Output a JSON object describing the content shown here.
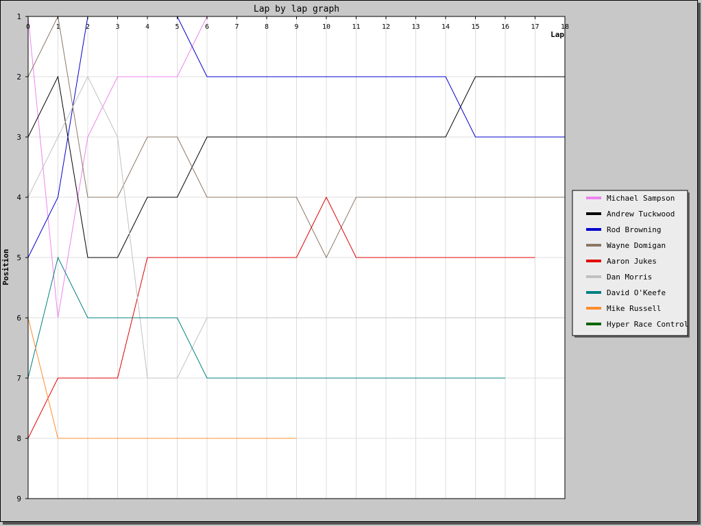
{
  "chart_data": {
    "type": "line",
    "title": "Lap by lap graph",
    "xlabel": "Lap",
    "ylabel": "Position",
    "xlim": [
      0,
      18
    ],
    "ylim": [
      1,
      9
    ],
    "y_inverted": true,
    "x_ticks": [
      0,
      1,
      2,
      3,
      4,
      5,
      6,
      7,
      8,
      9,
      10,
      11,
      12,
      13,
      14,
      15,
      16,
      17,
      18
    ],
    "y_ticks": [
      1,
      2,
      3,
      4,
      5,
      6,
      7,
      8,
      9
    ],
    "grid": true,
    "legend_position": "right",
    "series": [
      {
        "name": "Michael Sampson",
        "color": "#ee82ee",
        "x": [
          0,
          1,
          2,
          3,
          4,
          5,
          6,
          7,
          8,
          9,
          10,
          11,
          12,
          13,
          14,
          15,
          16,
          17,
          18
        ],
        "y": [
          1,
          6,
          3,
          2,
          2,
          2,
          1,
          1,
          1,
          1,
          1,
          1,
          1,
          1,
          1,
          1,
          1,
          1,
          1
        ]
      },
      {
        "name": "Andrew Tuckwood",
        "color": "#000000",
        "x": [
          0,
          1,
          2,
          3,
          4,
          5,
          6,
          7,
          8,
          9,
          10,
          11,
          12,
          13,
          14,
          15,
          16,
          17,
          18
        ],
        "y": [
          3,
          2,
          5,
          5,
          4,
          4,
          3,
          3,
          3,
          3,
          3,
          3,
          3,
          3,
          3,
          2,
          2,
          2,
          2
        ]
      },
      {
        "name": "Rod Browning",
        "color": "#0000cc",
        "x": [
          0,
          1,
          2,
          3,
          4,
          5,
          6,
          7,
          8,
          9,
          10,
          11,
          12,
          13,
          14,
          15,
          16,
          17,
          18
        ],
        "y": [
          5,
          4,
          1,
          1,
          1,
          1,
          2,
          2,
          2,
          2,
          2,
          2,
          2,
          2,
          2,
          3,
          3,
          3,
          3
        ]
      },
      {
        "name": "Wayne Domigan",
        "color": "#8b7765",
        "x": [
          0,
          1,
          2,
          3,
          4,
          5,
          6,
          7,
          8,
          9,
          10,
          11,
          12,
          13,
          14,
          15,
          16,
          17,
          18
        ],
        "y": [
          2,
          1,
          4,
          4,
          3,
          3,
          4,
          4,
          4,
          4,
          5,
          4,
          4,
          4,
          4,
          4,
          4,
          4,
          4
        ]
      },
      {
        "name": "Aaron Jukes",
        "color": "#e00000",
        "x": [
          0,
          1,
          2,
          3,
          4,
          5,
          6,
          7,
          8,
          9,
          10,
          11,
          12,
          13,
          14,
          15,
          16,
          17
        ],
        "y": [
          8,
          7,
          7,
          7,
          5,
          5,
          5,
          5,
          5,
          5,
          4,
          5,
          5,
          5,
          5,
          5,
          5,
          5
        ]
      },
      {
        "name": "Dan Morris",
        "color": "#c0c0c0",
        "x": [
          0,
          1,
          2,
          3,
          4,
          5,
          6,
          7,
          8,
          9,
          10,
          11,
          12,
          13,
          14,
          15,
          16,
          17,
          18
        ],
        "y": [
          4,
          3,
          2,
          3,
          7,
          7,
          6,
          6,
          6,
          6,
          6,
          6,
          6,
          6,
          6,
          6,
          6,
          6,
          6
        ]
      },
      {
        "name": "David O'Keefe",
        "color": "#008080",
        "x": [
          0,
          1,
          2,
          3,
          4,
          5,
          6,
          7,
          8,
          9,
          10,
          11,
          12,
          13,
          14,
          15,
          16
        ],
        "y": [
          7,
          5,
          6,
          6,
          6,
          6,
          7,
          7,
          7,
          7,
          7,
          7,
          7,
          7,
          7,
          7,
          7
        ]
      },
      {
        "name": "Mike Russell",
        "color": "#ff8c2a",
        "x": [
          0,
          1,
          2,
          3,
          4,
          5,
          6,
          7,
          8,
          9
        ],
        "y": [
          6,
          8,
          8,
          8,
          8,
          8,
          8,
          8,
          8,
          8
        ]
      },
      {
        "name": "Hyper Race Control",
        "color": "#006400",
        "x": [],
        "y": []
      }
    ]
  }
}
